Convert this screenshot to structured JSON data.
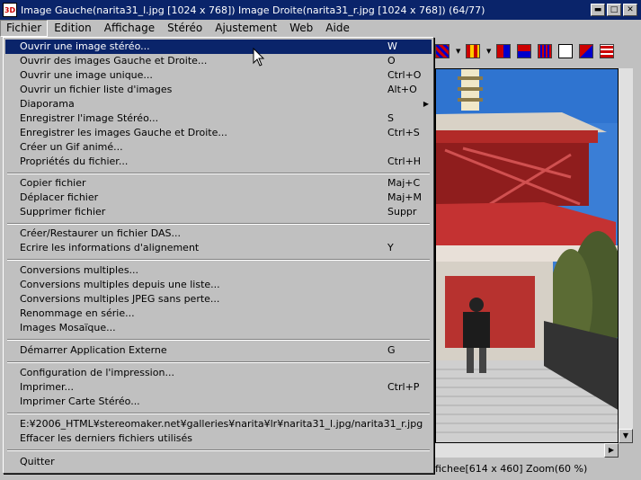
{
  "window": {
    "title": "Image Gauche(narita31_l.jpg [1024 x 768]) Image Droite(narita31_r.jpg [1024 x 768])  (64/77)",
    "app_icon": "3D"
  },
  "menubar": {
    "items": [
      "Fichier",
      "Edition",
      "Affichage",
      "Stéréo",
      "Ajustement",
      "Web",
      "Aide"
    ]
  },
  "file_menu": {
    "items": [
      {
        "label": "Ouvrir une image stéréo...",
        "shortcut": "W"
      },
      {
        "label": "Ouvrir des images Gauche et Droite...",
        "shortcut": "O"
      },
      {
        "label": "Ouvrir une image unique...",
        "shortcut": "Ctrl+O"
      },
      {
        "label": "Ouvrir un fichier liste d'images",
        "shortcut": "Alt+O"
      },
      {
        "label": "Diaporama",
        "shortcut": ""
      },
      {
        "label": "Enregistrer l'image Stéréo...",
        "shortcut": "S"
      },
      {
        "label": "Enregistrer les images Gauche et Droite...",
        "shortcut": "Ctrl+S"
      },
      {
        "label": "Créer un Gif animé...",
        "shortcut": ""
      },
      {
        "label": "Propriétés du fichier...",
        "shortcut": "Ctrl+H"
      },
      {
        "label": "Copier fichier",
        "shortcut": "Maj+C"
      },
      {
        "label": "Déplacer fichier",
        "shortcut": "Maj+M"
      },
      {
        "label": "Supprimer fichier",
        "shortcut": "Suppr"
      },
      {
        "label": "Créer/Restaurer un fichier DAS...",
        "shortcut": ""
      },
      {
        "label": "Ecrire les informations d'alignement",
        "shortcut": "Y"
      },
      {
        "label": "Conversions multiples...",
        "shortcut": ""
      },
      {
        "label": "Conversions multiples depuis une liste...",
        "shortcut": ""
      },
      {
        "label": "Conversions multiples JPEG sans perte...",
        "shortcut": ""
      },
      {
        "label": "Renommage en série...",
        "shortcut": ""
      },
      {
        "label": "Images Mosaïque...",
        "shortcut": ""
      },
      {
        "label": "Démarrer Application Externe",
        "shortcut": "G"
      },
      {
        "label": "Configuration de l'impression...",
        "shortcut": ""
      },
      {
        "label": "Imprimer...",
        "shortcut": "Ctrl+P"
      },
      {
        "label": "Imprimer Carte Stéréo...",
        "shortcut": ""
      },
      {
        "label": "E:¥2006_HTML¥stereomaker.net¥galleries¥narita¥lr¥narita31_l.jpg/narita31_r.jpg",
        "shortcut": ""
      },
      {
        "label": "Effacer les derniers fichiers utilisés",
        "shortcut": ""
      },
      {
        "label": "Quitter",
        "shortcut": ""
      }
    ]
  },
  "status": {
    "text": "fichee[614 x 460]  Zoom(60 %)"
  },
  "colors": {
    "title_bg": "#0a246a",
    "menu_highlight": "#0a246a",
    "face": "#c0c0c0"
  }
}
